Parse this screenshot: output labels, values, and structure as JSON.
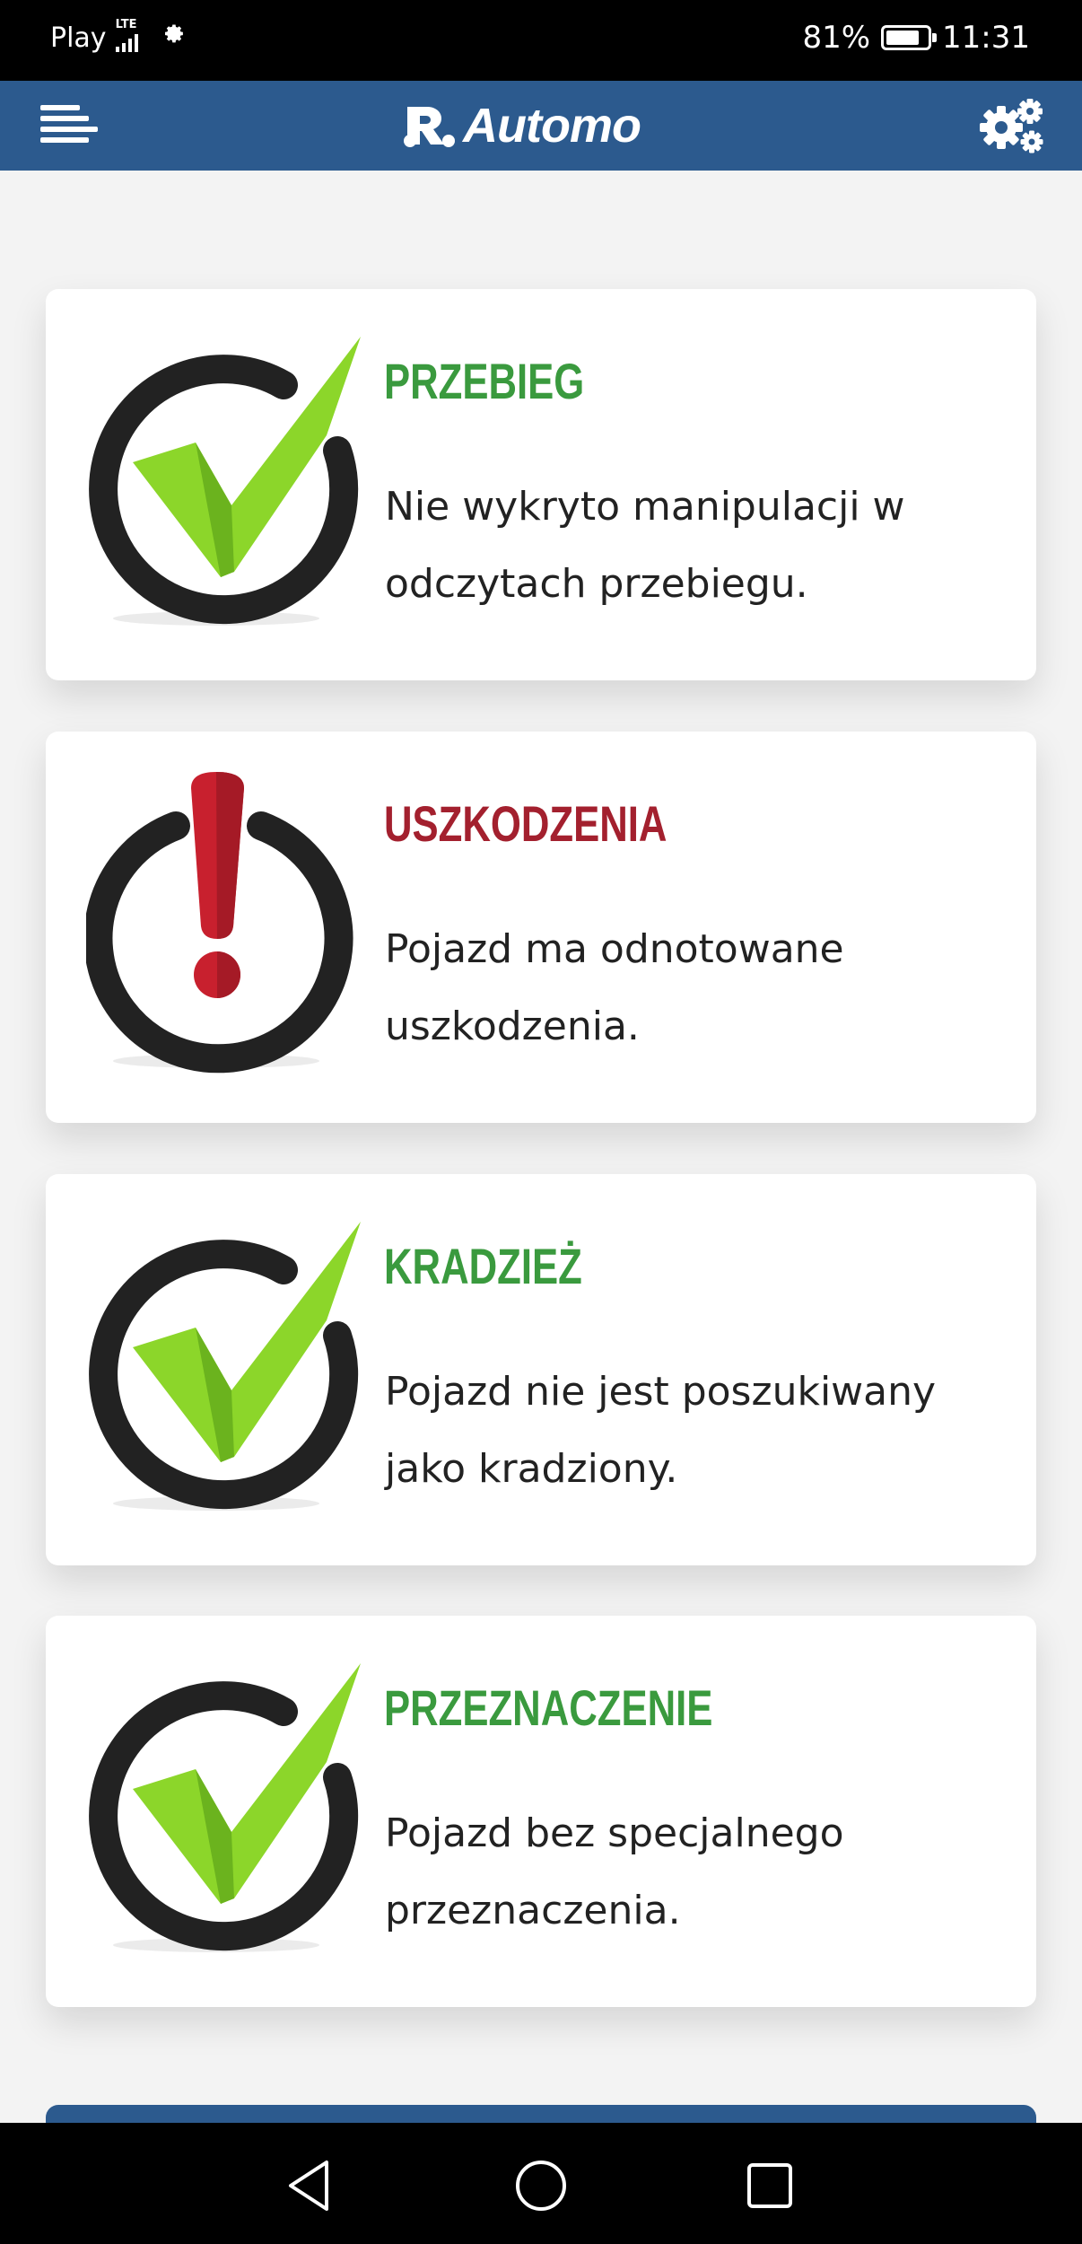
{
  "status_bar": {
    "carrier": "Play",
    "network": "LTE",
    "battery_text": "81%",
    "battery_level": 0.81,
    "time": "11:31",
    "icons": [
      "signal-icon",
      "gear-icon",
      "battery-icon"
    ]
  },
  "header": {
    "logo_text": "Automo",
    "menu_icon": "hamburger-icon",
    "settings_icon": "settings-gears-icon",
    "color": "#2c5a8e"
  },
  "cards": [
    {
      "title": "PRZEBIEG",
      "text": "Nie wykryto manipulacji w odczytach przebiegu.",
      "status": "ok",
      "icon": "check-icon",
      "title_color": "#3a9a3e"
    },
    {
      "title": "USZKODZENIA",
      "text": "Pojazd ma odnotowane uszkodzenia.",
      "status": "warning",
      "icon": "exclamation-icon",
      "title_color": "#a3202e"
    },
    {
      "title": "KRADZIEŻ",
      "text": "Pojazd nie jest poszukiwany jako kradziony.",
      "status": "ok",
      "icon": "check-icon",
      "title_color": "#3a9a3e"
    },
    {
      "title": "PRZEZNACZENIE",
      "text": "Pojazd bez specjalnego przeznaczenia.",
      "status": "ok",
      "icon": "check-icon",
      "title_color": "#3a9a3e"
    }
  ],
  "nav_bar": {
    "icons": [
      "back-icon",
      "home-icon",
      "recents-icon"
    ]
  }
}
